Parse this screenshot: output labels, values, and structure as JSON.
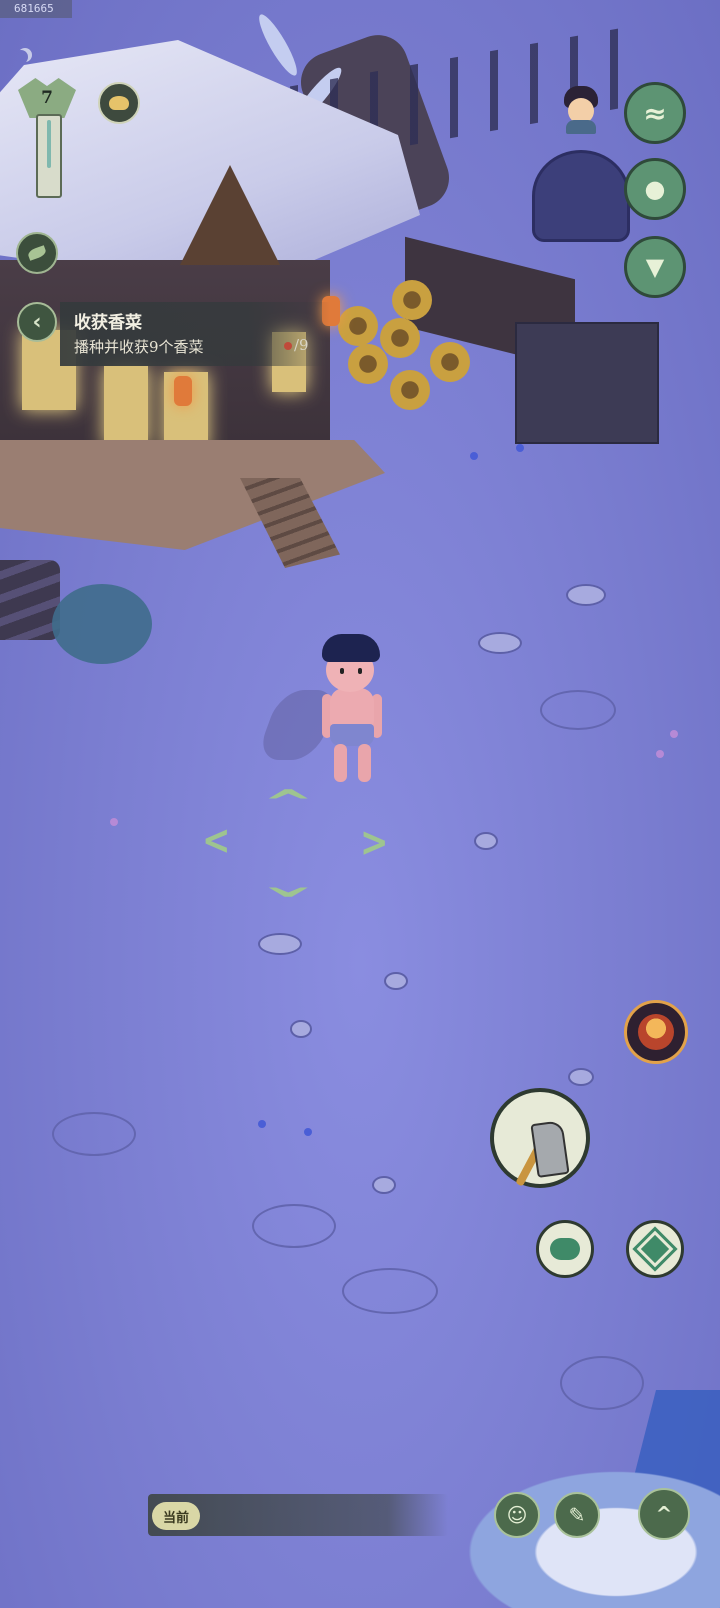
{
  "debug": {
    "uid": "681665"
  },
  "player": {
    "level": "7"
  },
  "quest": {
    "title": "收获香菜",
    "description": "播种并收获9个香菜",
    "progress": "/9"
  },
  "chat": {
    "channel_tag": "当前"
  },
  "icons": {
    "moon": "moon-icon",
    "day_night": "sun-moon-icon",
    "leaf": "leaf-icon",
    "back": "chevron-left-icon",
    "wave": "wave-icon",
    "bag": "bag-icon",
    "ox": "ox-head-icon",
    "demon": "demon-face-icon",
    "axe": "axe-icon",
    "cloud": "cloud-icon",
    "shuriken": "shuriken-icon",
    "emote": "smile-icon",
    "edit": "brush-icon",
    "expand": "chevron-up-icon"
  },
  "colors": {
    "ground": "#7c7fd2",
    "ui_green": "#5d9473",
    "quest_panel": "#343a3c",
    "move_indicator": "#9ec490"
  }
}
